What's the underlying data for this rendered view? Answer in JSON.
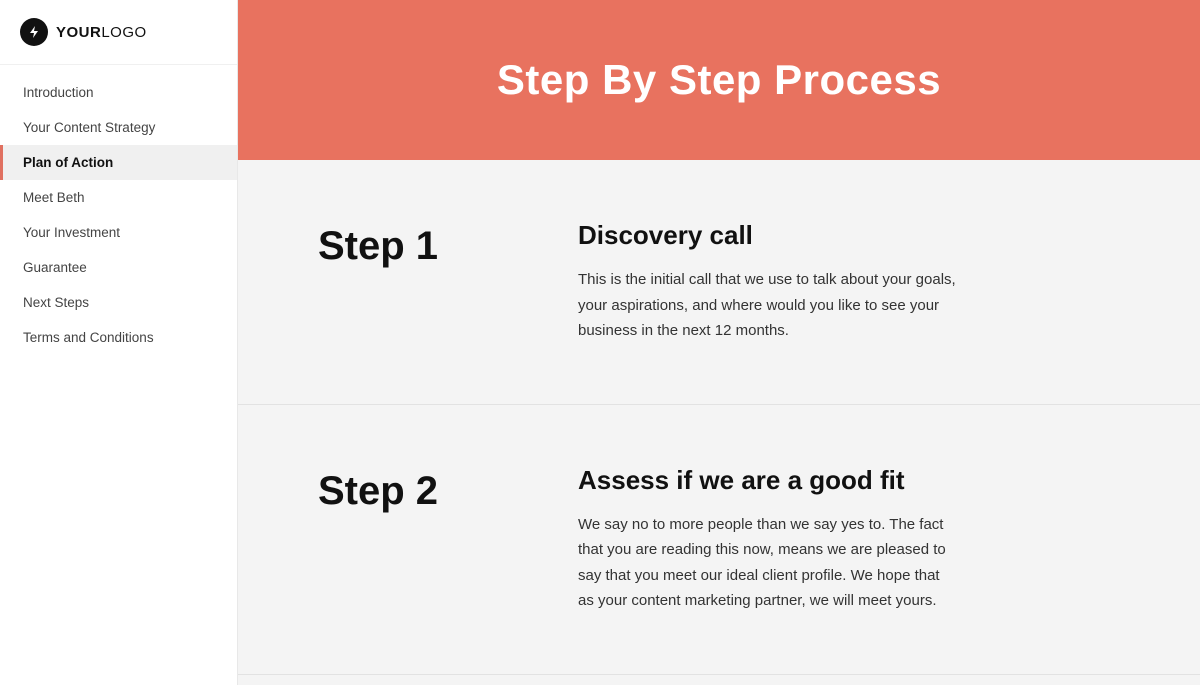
{
  "logo": {
    "icon": "⚡",
    "text_bold": "YOUR",
    "text_regular": "LOGO"
  },
  "sidebar": {
    "items": [
      {
        "id": "introduction",
        "label": "Introduction",
        "active": false
      },
      {
        "id": "your-content-strategy",
        "label": "Your Content Strategy",
        "active": false
      },
      {
        "id": "plan-of-action",
        "label": "Plan of Action",
        "active": true
      },
      {
        "id": "meet-beth",
        "label": "Meet Beth",
        "active": false
      },
      {
        "id": "your-investment",
        "label": "Your Investment",
        "active": false
      },
      {
        "id": "guarantee",
        "label": "Guarantee",
        "active": false
      },
      {
        "id": "next-steps",
        "label": "Next Steps",
        "active": false
      },
      {
        "id": "terms-and-conditions",
        "label": "Terms and Conditions",
        "active": false
      }
    ]
  },
  "header": {
    "title": "Step By Step Process"
  },
  "steps": [
    {
      "number": "Step 1",
      "title": "Discovery call",
      "description": "This is the initial call that we use to talk about your goals, your aspirations, and where would you like to see your business in the next 12 months."
    },
    {
      "number": "Step 2",
      "title": "Assess if we are a good fit",
      "description": "We say no to more people than we say yes to. The fact that you are reading this now, means we are pleased to say that you meet our ideal client profile. We hope that as your content marketing partner, we will meet yours."
    }
  ]
}
